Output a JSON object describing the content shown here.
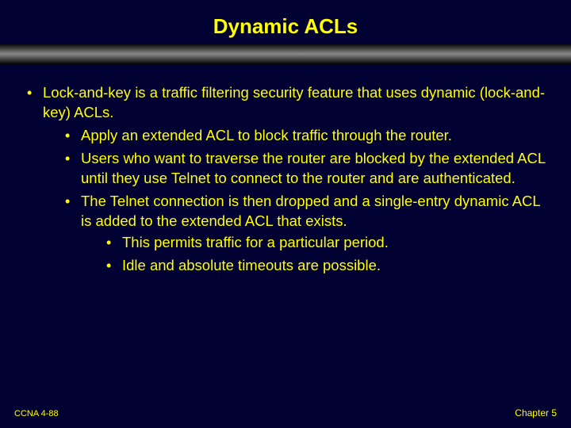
{
  "slide": {
    "title": "Dynamic ACLs",
    "footer_left": "CCNA 4-88",
    "footer_right": "Chapter 5",
    "bullets": {
      "b1": "Lock-and-key is a traffic filtering security feature that uses dynamic (lock-and-key) ACLs.",
      "b1_1": "Apply an extended ACL to block traffic through the router.",
      "b1_2": "Users who want to traverse the router are blocked by the extended ACL until they use Telnet to connect to the router and are authenticated.",
      "b1_3": "The Telnet connection is then dropped and a single-entry dynamic ACL is added to the extended ACL that exists.",
      "b1_3_1": "This permits traffic for a particular period.",
      "b1_3_2": "Idle and absolute timeouts are possible."
    }
  }
}
